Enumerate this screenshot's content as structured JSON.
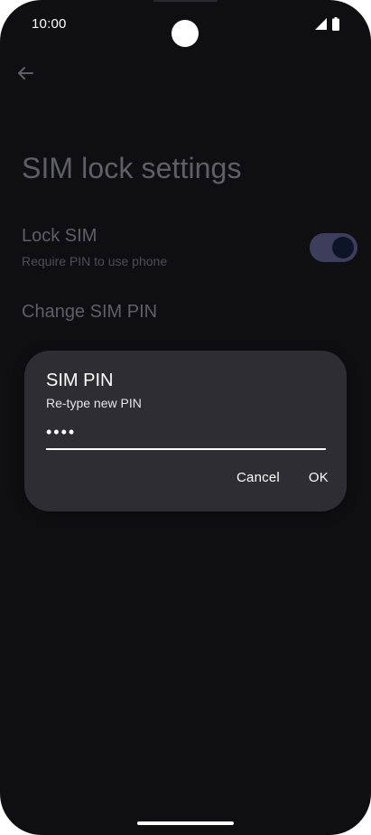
{
  "status_bar": {
    "time": "10:00",
    "icons": [
      "signal-icon",
      "battery-icon"
    ]
  },
  "navigation": {
    "back_icon": "arrow-back-icon"
  },
  "page": {
    "title": "SIM lock settings"
  },
  "settings": {
    "lock_sim": {
      "title": "Lock SIM",
      "subtitle": "Require PIN to use phone",
      "enabled": true
    },
    "change_sim_pin": {
      "title": "Change SIM PIN"
    }
  },
  "dialog": {
    "title": "SIM PIN",
    "message": "Re-type new PIN",
    "pin_value": "••••",
    "cancel_label": "Cancel",
    "ok_label": "OK"
  },
  "colors": {
    "background": "#0f0f12",
    "dialog_background": "#2d2d33",
    "text_primary": "#ffffff",
    "text_dimmed": "#5f5f66",
    "toggle_track": "#3e3e5c",
    "toggle_knob": "#0e1428"
  }
}
